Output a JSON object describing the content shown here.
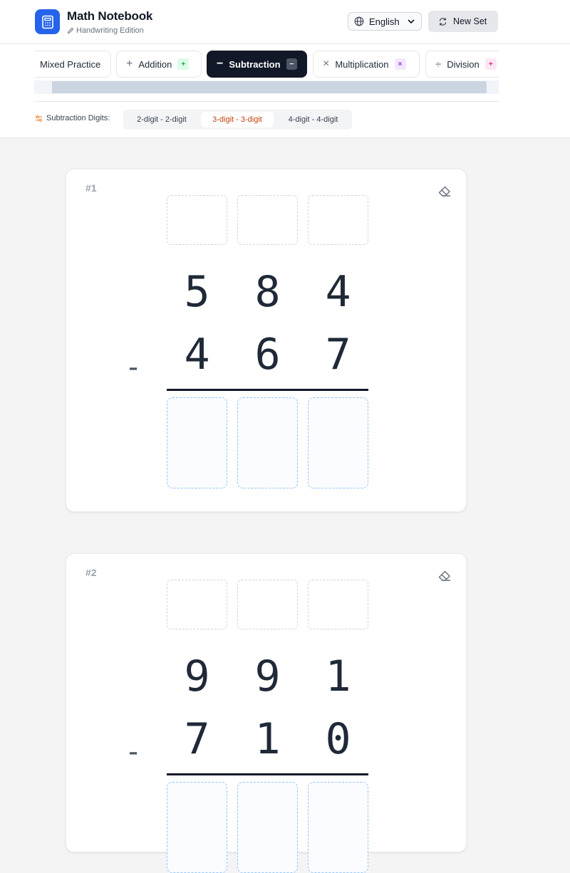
{
  "app": {
    "title": "Math Notebook",
    "subtitle": "Handwriting Edition",
    "accent_color": "#2563eb",
    "logo_icon": "calculator-icon"
  },
  "language": {
    "label": "English",
    "icon": "globe-icon"
  },
  "new_set": {
    "label": "New Set",
    "icon": "refresh-icon"
  },
  "tabs": [
    {
      "label": "Mixed Practice",
      "icon": "",
      "badge": ""
    },
    {
      "label": "Addition",
      "icon": "+",
      "badge": "+",
      "badge_color": "#dcfce7",
      "badge_text": "#16a34a"
    },
    {
      "label": "Subtraction",
      "icon": "−",
      "badge": "−",
      "active": true,
      "badge_color": "#4b5563",
      "badge_text": "#ffffff"
    },
    {
      "label": "Multiplication",
      "icon": "×",
      "badge": "×",
      "badge_color": "#f3e8ff",
      "badge_text": "#9333ea"
    },
    {
      "label": "Division",
      "icon": "÷",
      "badge": "+",
      "badge_color": "#fce7f3",
      "badge_text": "#db2777"
    }
  ],
  "digits": {
    "label": "Subtraction Digits:",
    "options": [
      "2-digit - 2-digit",
      "3-digit - 3-digit",
      "4-digit - 4-digit"
    ],
    "selected": "3-digit - 3-digit"
  },
  "problems": [
    {
      "number": "#1",
      "operator": "-",
      "top": [
        "5",
        "8",
        "4"
      ],
      "bottom": [
        "4",
        "6",
        "7"
      ]
    },
    {
      "number": "#2",
      "operator": "-",
      "top": [
        "9",
        "9",
        "1"
      ],
      "bottom": [
        "7",
        "1",
        "0"
      ]
    }
  ]
}
